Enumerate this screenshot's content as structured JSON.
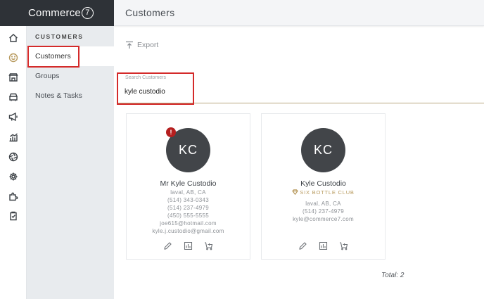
{
  "brand": {
    "name": "Commerce",
    "mark": "7"
  },
  "header": {
    "title": "Customers"
  },
  "rail": {
    "items": [
      {
        "icon": "home-icon"
      },
      {
        "icon": "smiley-icon",
        "active": true
      },
      {
        "icon": "store-icon"
      },
      {
        "icon": "sales-icon"
      },
      {
        "icon": "megaphone-icon"
      },
      {
        "icon": "chart-icon"
      },
      {
        "icon": "aperture-icon"
      },
      {
        "icon": "gear-icon"
      },
      {
        "icon": "puzzle-icon"
      },
      {
        "icon": "clipboard-icon"
      }
    ]
  },
  "subnav": {
    "heading": "CUSTOMERS",
    "items": [
      {
        "label": "Customers",
        "active": true
      },
      {
        "label": "Groups"
      },
      {
        "label": "Notes & Tasks"
      }
    ]
  },
  "toolbar": {
    "export_label": "Export"
  },
  "search": {
    "label": "Search Customers",
    "value": "kyle custodio"
  },
  "customers": [
    {
      "initials": "KC",
      "alert": "!",
      "name": "Mr Kyle Custodio",
      "location": "laval, AB, CA",
      "phones": [
        "(514) 343-0343",
        "(514) 237-4979",
        "(450) 555-5555"
      ],
      "emails": [
        "joe615@hotmail.com",
        "kyle.j.custodio@gmail.com"
      ]
    },
    {
      "initials": "KC",
      "name": "Kyle Custodio",
      "club": "SIX BOTTLE CLUB",
      "location": "laval, AB, CA",
      "phones": [
        "(514) 237-4979"
      ],
      "emails": [
        "kyle@commerce7.com"
      ]
    }
  ],
  "footer": {
    "total": "Total: 2"
  },
  "colors": {
    "accent": "#b89a5e",
    "highlight": "#d42a2a",
    "sidebar_dark": "#2e3237",
    "avatar": "#424549"
  }
}
